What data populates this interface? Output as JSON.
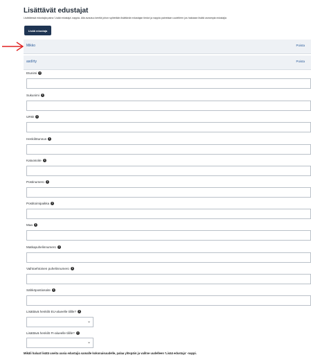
{
  "page": {
    "title": "Lisättävät edustajat",
    "description": "Lisättäessä edustajia paina 'Lisää edustaja'-nappia. Alla avautuu kenttä johon syötetään lisättävän edustajan tiedot ja nappia painetaan uudelleen jos halutaan lisätä useampia edustajia",
    "add_button": "Lisää edustaja"
  },
  "representatives": [
    {
      "name": "Mikko",
      "delete_label": "Poista"
    },
    {
      "name": "asd/rty",
      "delete_label": "Poista"
    }
  ],
  "form": {
    "fields": [
      {
        "label": "Etunimi"
      },
      {
        "label": "Sukunimi"
      },
      {
        "label": "URID"
      },
      {
        "label": "Henkilötunnus"
      },
      {
        "label": "Katuosoite"
      },
      {
        "label": "Postinumero"
      },
      {
        "label": "Postitoimipaikka"
      },
      {
        "label": "Maa"
      },
      {
        "label": "Matkapuhelinnumero"
      },
      {
        "label": "Vaihtoehtoinen puhelinnumero"
      },
      {
        "label": "Sähköpostiosoite"
      }
    ],
    "selects": [
      {
        "label": "Lisättävä henkilö EU-alueelle tilille?",
        "value": ""
      },
      {
        "label": "Lisättävä henkilö FI-alueelle tilille?",
        "value": ""
      }
    ]
  },
  "footer_note": "Mikäli haluat lisätä useita uusia edustajia samalle kokonaisuudelle, palaa ylöspäin ja valitse uudelleen 'Lisää edustaja' -nappi.",
  "icons": {
    "info": "info-circle-icon",
    "chevron": "chevron-down-icon",
    "arrow": "red-arrow-icon"
  },
  "colors": {
    "accent": "#1f3553",
    "link": "#2a5b9a",
    "arrow": "#e02020"
  }
}
